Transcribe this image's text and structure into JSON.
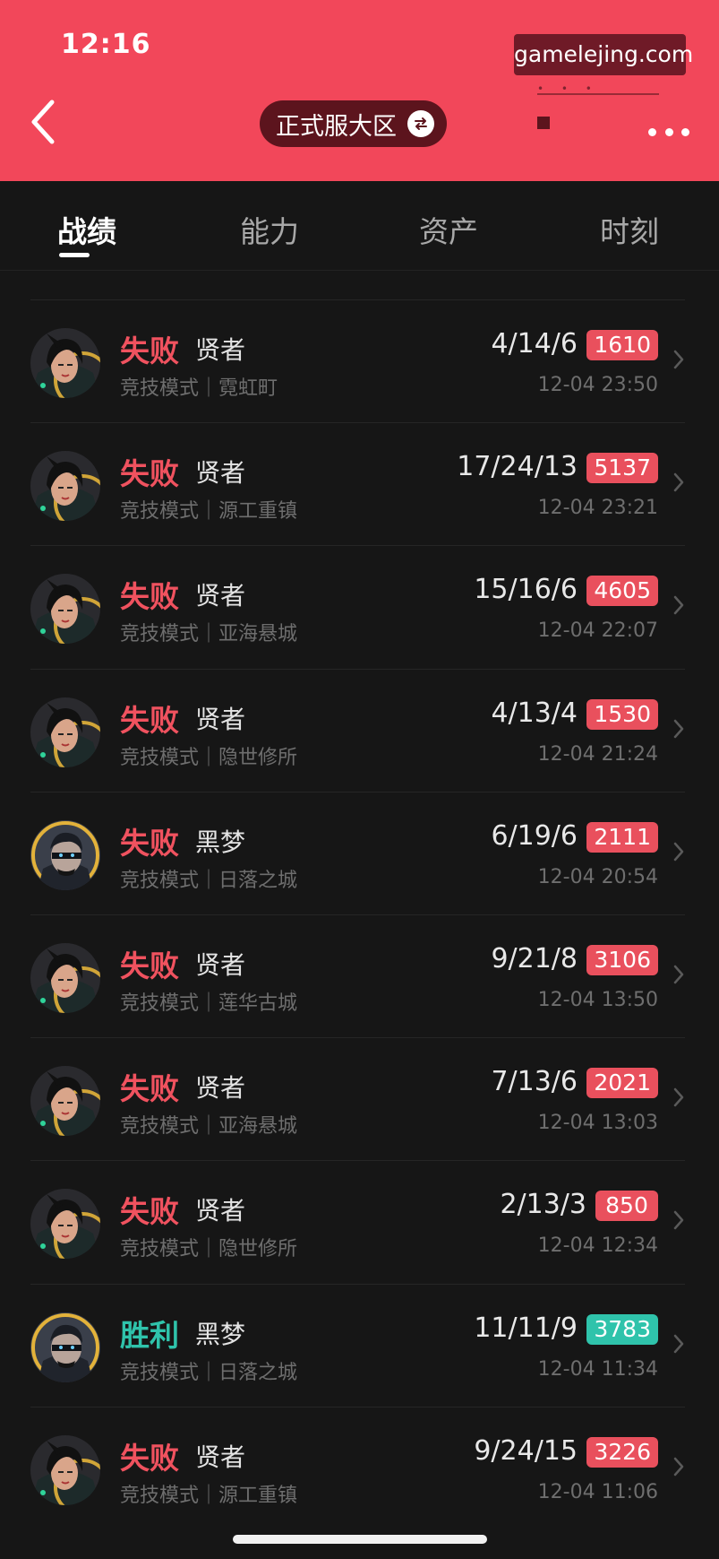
{
  "status_bar": {
    "time": "12:16"
  },
  "watermark": "gamelejing.com",
  "header": {
    "server": "正式服大区"
  },
  "tabs": [
    {
      "label": "战绩",
      "active": true
    },
    {
      "label": "能力",
      "active": false
    },
    {
      "label": "资产",
      "active": false
    },
    {
      "label": "时刻",
      "active": false
    }
  ],
  "colors": {
    "header": "#f2475a",
    "lose": "#f0525f",
    "win": "#2fc3ab",
    "background": "#161616"
  },
  "matches": [
    {
      "result": "失败",
      "outcome": "lose",
      "hero": "贤者",
      "mode_map": "竞技模式｜霓虹町",
      "kda": "4/14/6",
      "score": "1610",
      "time": "12-04 23:50",
      "avatar": "sage-avatar-icon"
    },
    {
      "result": "失败",
      "outcome": "lose",
      "hero": "贤者",
      "mode_map": "竞技模式｜源工重镇",
      "kda": "17/24/13",
      "score": "5137",
      "time": "12-04 23:21",
      "avatar": "sage-avatar-icon"
    },
    {
      "result": "失败",
      "outcome": "lose",
      "hero": "贤者",
      "mode_map": "竞技模式｜亚海悬城",
      "kda": "15/16/6",
      "score": "4605",
      "time": "12-04 22:07",
      "avatar": "sage-avatar-icon"
    },
    {
      "result": "失败",
      "outcome": "lose",
      "hero": "贤者",
      "mode_map": "竞技模式｜隐世修所",
      "kda": "4/13/4",
      "score": "1530",
      "time": "12-04 21:24",
      "avatar": "sage-avatar-icon"
    },
    {
      "result": "失败",
      "outcome": "lose",
      "hero": "黑梦",
      "mode_map": "竞技模式｜日落之城",
      "kda": "6/19/6",
      "score": "2111",
      "time": "12-04 20:54",
      "avatar": "omen-avatar-icon"
    },
    {
      "result": "失败",
      "outcome": "lose",
      "hero": "贤者",
      "mode_map": "竞技模式｜莲华古城",
      "kda": "9/21/8",
      "score": "3106",
      "time": "12-04 13:50",
      "avatar": "sage-avatar-icon"
    },
    {
      "result": "失败",
      "outcome": "lose",
      "hero": "贤者",
      "mode_map": "竞技模式｜亚海悬城",
      "kda": "7/13/6",
      "score": "2021",
      "time": "12-04 13:03",
      "avatar": "sage-avatar-icon"
    },
    {
      "result": "失败",
      "outcome": "lose",
      "hero": "贤者",
      "mode_map": "竞技模式｜隐世修所",
      "kda": "2/13/3",
      "score": "850",
      "time": "12-04 12:34",
      "avatar": "sage-avatar-icon"
    },
    {
      "result": "胜利",
      "outcome": "win",
      "hero": "黑梦",
      "mode_map": "竞技模式｜日落之城",
      "kda": "11/11/9",
      "score": "3783",
      "time": "12-04 11:34",
      "avatar": "omen-avatar-icon"
    },
    {
      "result": "失败",
      "outcome": "lose",
      "hero": "贤者",
      "mode_map": "竞技模式｜源工重镇",
      "kda": "9/24/15",
      "score": "3226",
      "time": "12-04 11:06",
      "avatar": "sage-avatar-icon"
    }
  ]
}
